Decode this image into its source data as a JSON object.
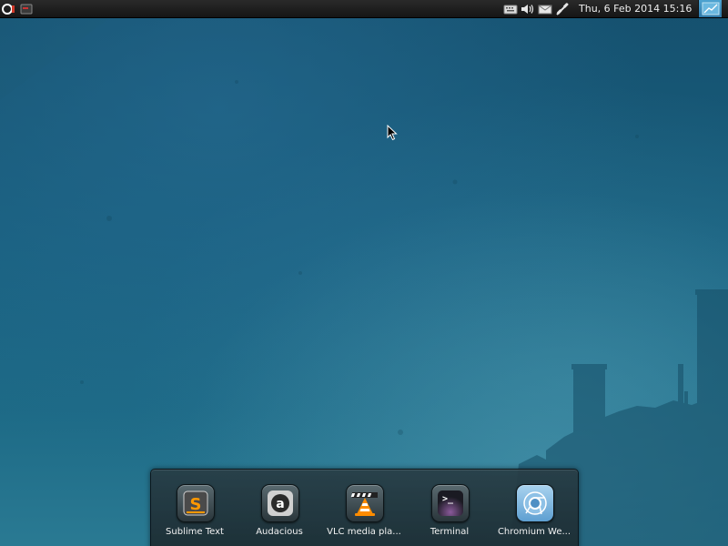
{
  "top_panel": {
    "menu_icon": "app-menu-icon",
    "task_icon": "window-task-icon",
    "tray": {
      "icons": [
        "keyboard-icon",
        "volume-icon",
        "mail-icon",
        "network-icon"
      ]
    },
    "clock": "Thu,  6 Feb 2014 15:16",
    "corner_icon": "show-desktop-icon"
  },
  "dock": {
    "items": [
      {
        "label": "Sublime Text",
        "icon": "sublime-text-icon"
      },
      {
        "label": "Audacious",
        "icon": "audacious-icon"
      },
      {
        "label": "VLC media pla...",
        "icon": "vlc-icon"
      },
      {
        "label": "Terminal",
        "icon": "terminal-icon"
      },
      {
        "label": "Chromium We...",
        "icon": "chromium-icon"
      }
    ]
  },
  "colors": {
    "wallpaper": "#19607f",
    "panel": "#1a1a1a",
    "dock": "#22363d",
    "accent": "#4da3d1"
  }
}
